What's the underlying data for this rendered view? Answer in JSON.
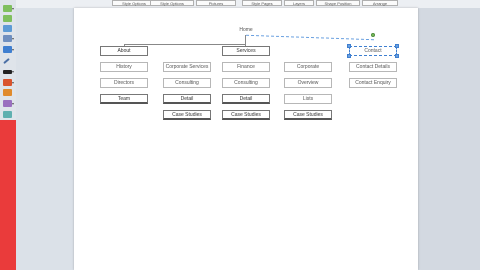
{
  "colors": {
    "accent_red": "#ea3b3b",
    "selection_blue": "#3f7fd0"
  },
  "ribbon_tabs": [
    "Style Options",
    "Style Options",
    "Pictures",
    "Style Pages",
    "Layers",
    "Shape Position",
    "Arrange"
  ],
  "toolbar": {
    "icons": [
      "grid-icon",
      "table-icon",
      "image-icon",
      "stack-icon",
      "line-icon",
      "rectangle-icon",
      "text-icon",
      "fill-icon",
      "lines-icon",
      "effects-icon",
      "shadow-icon",
      "arrow-icon"
    ]
  },
  "sitemap": {
    "home": "Home",
    "about": "About",
    "services": "Services",
    "contact": "Contact",
    "about_children": [
      "History",
      "Directors",
      "Team"
    ],
    "col2_children": [
      "Corporate Services",
      "Consulting",
      "Detail",
      "Case Studies"
    ],
    "services_children": [
      "Finance",
      "Consulting",
      "Detail",
      "Case Studies"
    ],
    "col4_children": [
      "Corporate",
      "Overview",
      "Lists",
      "Case Studies"
    ],
    "contact_children": [
      "Contact Details",
      "Contact Enquiry"
    ]
  }
}
